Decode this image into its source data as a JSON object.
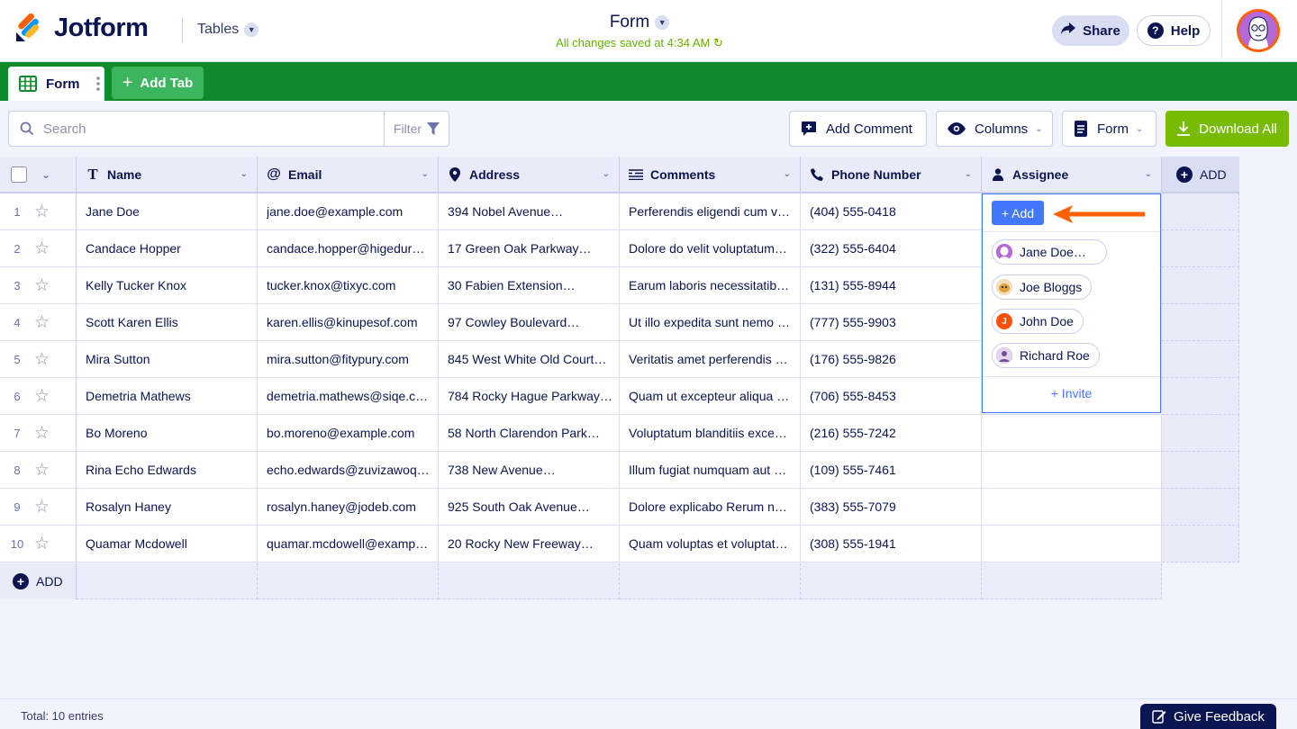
{
  "app": {
    "logo_text": "Jotform",
    "tables_label": "Tables",
    "form_title": "Form",
    "saved_status": "All changes saved at 4:34 AM",
    "share_label": "Share",
    "help_label": "Help"
  },
  "tabs": {
    "active_label": "Form",
    "add_label": "Add Tab"
  },
  "toolbar": {
    "search_placeholder": "Search",
    "filter_label": "Filter",
    "add_comment_label": "Add Comment",
    "columns_label": "Columns",
    "form_label": "Form",
    "download_label": "Download All"
  },
  "table": {
    "add_column_label": "ADD",
    "add_row_label": "ADD",
    "columns": [
      {
        "label": "Name",
        "icon": "text-icon"
      },
      {
        "label": "Email",
        "icon": "at-icon"
      },
      {
        "label": "Address",
        "icon": "location-pin-icon"
      },
      {
        "label": "Comments",
        "icon": "text-lines-icon"
      },
      {
        "label": "Phone Number",
        "icon": "phone-icon"
      },
      {
        "label": "Assignee",
        "icon": "user-icon"
      }
    ],
    "rows": [
      {
        "num": "1",
        "name": "Jane Doe",
        "email": "jane.doe@example.com",
        "address": "394 Nobel Avenue…",
        "comments": "Perferendis eligendi cum v…",
        "phone": "(404) 555-0418"
      },
      {
        "num": "2",
        "name": "Candace Hopper",
        "email": "candace.hopper@higedur…",
        "address": "17 Green Oak Parkway…",
        "comments": "Dolore do velit voluptatum…",
        "phone": "(322) 555-6404"
      },
      {
        "num": "3",
        "name": "Kelly Tucker Knox",
        "email": "tucker.knox@tixyc.com",
        "address": "30 Fabien Extension…",
        "comments": "Earum laboris necessitatib…",
        "phone": "(131) 555-8944"
      },
      {
        "num": "4",
        "name": "Scott Karen Ellis",
        "email": "karen.ellis@kinupesof.com",
        "address": "97 Cowley Boulevard…",
        "comments": "Ut illo expedita sunt nemo …",
        "phone": "(777) 555-9903"
      },
      {
        "num": "5",
        "name": "Mira Sutton",
        "email": "mira.sutton@fitypury.com",
        "address": "845 West White Old Court…",
        "comments": "Veritatis amet perferendis …",
        "phone": "(176) 555-9826"
      },
      {
        "num": "6",
        "name": "Demetria Mathews",
        "email": "demetria.mathews@siqe.c…",
        "address": "784 Rocky Hague Parkway…",
        "comments": "Quam ut excepteur aliqua …",
        "phone": "(706) 555-8453"
      },
      {
        "num": "7",
        "name": "Bo Moreno",
        "email": "bo.moreno@example.com",
        "address": "58 North Clarendon Park…",
        "comments": "Voluptatum blanditiis exce…",
        "phone": "(216) 555-7242"
      },
      {
        "num": "8",
        "name": "Rina Echo Edwards",
        "email": "echo.edwards@zuvizawoq…",
        "address": "738 New Avenue…",
        "comments": "Illum fugiat numquam aut …",
        "phone": "(109) 555-7461"
      },
      {
        "num": "9",
        "name": "Rosalyn Haney",
        "email": "rosalyn.haney@jodeb.com",
        "address": "925 South Oak Avenue…",
        "comments": "Dolore explicabo Rerum n…",
        "phone": "(383) 555-7079"
      },
      {
        "num": "10",
        "name": "Quamar Mcdowell",
        "email": "quamar.mcdowell@examp…",
        "address": "20 Rocky New Freeway…",
        "comments": "Quam voluptas et voluptat…",
        "phone": "(308) 555-1941"
      }
    ]
  },
  "assignee_popup": {
    "add_label": "+ Add",
    "users": [
      {
        "name": "Jane Doe…",
        "avatar_color": "#9c4cc0"
      },
      {
        "name": "Joe Bloggs",
        "avatar_color": "#f0b45a"
      },
      {
        "name": "John Doe",
        "avatar_color": "#ff4f0a",
        "initial": "J"
      },
      {
        "name": "Richard Roe",
        "avatar_color": "#7a4c9c"
      }
    ],
    "invite_label": "+ Invite"
  },
  "footer": {
    "total_label": "Total: 10 entries",
    "feedback_label": "Give Feedback"
  },
  "colors": {
    "brand_green": "#0f8a2c",
    "download_green": "#78bb07",
    "accent_blue": "#4277ff",
    "annotation_arrow": "#ff6100"
  }
}
